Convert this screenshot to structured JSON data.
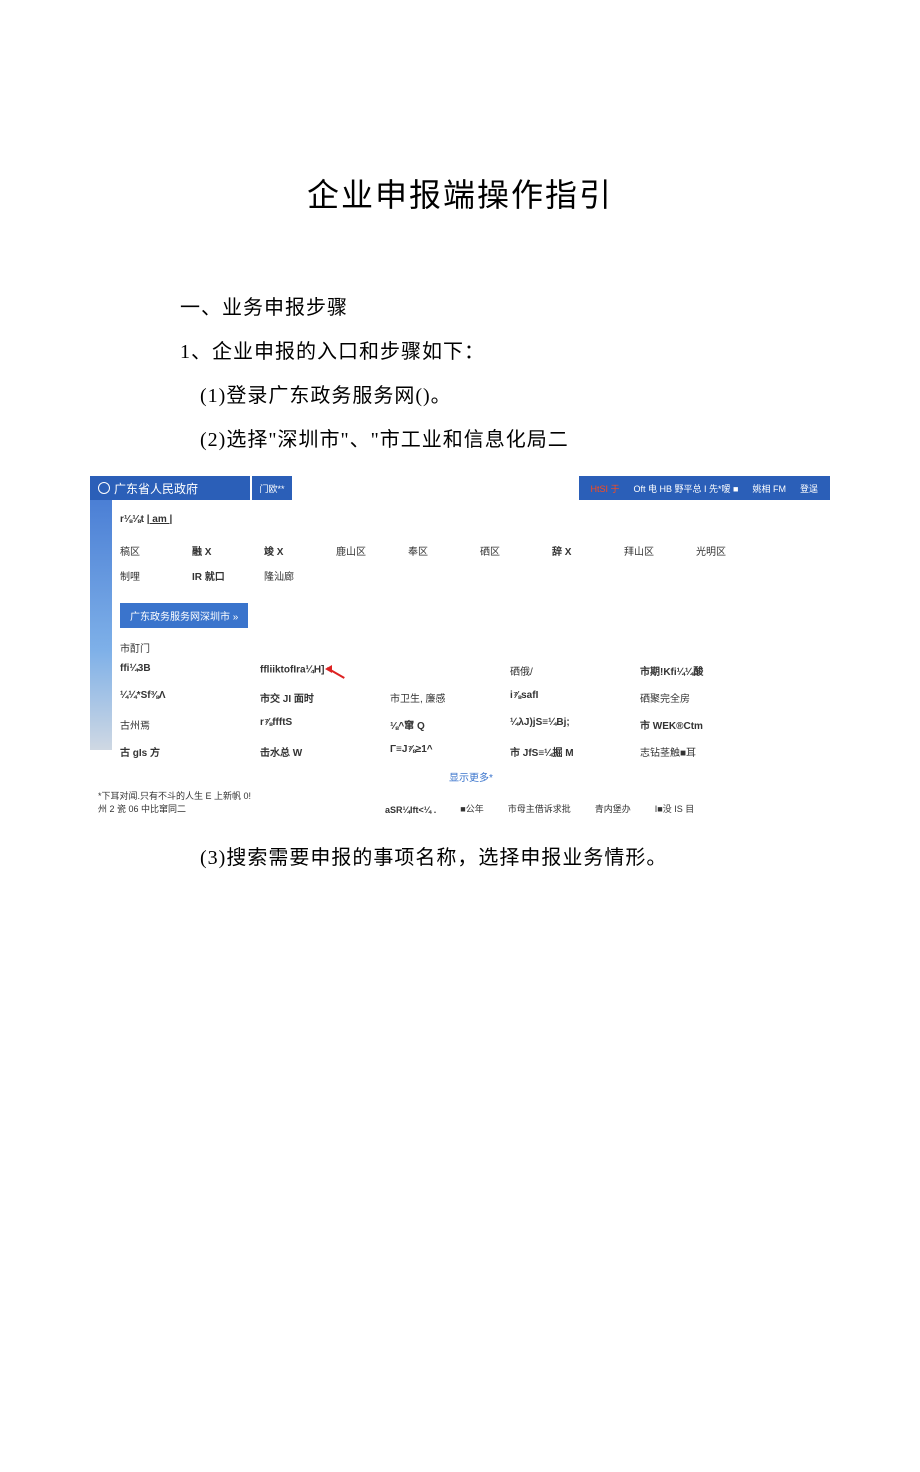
{
  "title": "企业申报端操作指引",
  "section1_heading": "一、业务申报步骤",
  "step1_intro": "1、企业申报的入口和步骤如下：",
  "step1_1": "(1)登录广东政务服务网()。",
  "step1_2": "(2)选择\"深圳市\"、\"市工业和信息化局二",
  "step1_3": "(3)搜索需要申报的事项名称，选择申报业务情形。",
  "screenshot": {
    "gov_name": "广东省人民政府",
    "tab": "门欧**",
    "topmenu": {
      "item1": "HtSI 于",
      "item2": "Oft 电 HB 野平总 I 先*嗳 ■",
      "item3": "姚相 FM",
      "item4": "登逞"
    },
    "location_line_a": "r⅛⅛t ",
    "location_line_b": "| am |",
    "districts": [
      "稿区",
      "融 X",
      "竣 X",
      "鹿山区",
      "奉区",
      "硒区",
      "辞 X",
      "拜山区",
      "光明区",
      "制哩",
      "IR 就口",
      "隆汕廊"
    ],
    "button": "广东政务服务网深圳市 »",
    "dept_label": "市酊门",
    "dept_grid": [
      [
        "ffi¼3B",
        "ffliiktofIra¼H]",
        "",
        "硒俄/",
        "市期!Kfi¼¼酸"
      ],
      [
        "¼¼*Sf⅜Λ",
        "市交 JI 面时",
        "市卫生, 廉感",
        "i⅞safI",
        "硒聚完全房"
      ],
      [
        "古州焉",
        "r⅞ffftS",
        "⅛^窜 Q",
        "¼λJ)jS≡¼Bj;",
        "市 WEK®Ctm"
      ],
      [
        "古 gIs 方",
        "击水总 W",
        "Γ≡J⅞≥1^",
        "市 JfS≡¼掘 M",
        "志钻茎触■耳"
      ]
    ],
    "more": "显示更多*",
    "footer": {
      "left_line1": "*下耳对闻.只有不斗的人生 E 上新帆 0!",
      "left_line2": "州 2 瓷 06 中比窜同二",
      "mid": "aSR¼Ift<¼ .",
      "r1": "■公年",
      "r2": "市母主借诉求批",
      "r3": "青内堡办",
      "r4": "I■没 IS 目"
    }
  }
}
